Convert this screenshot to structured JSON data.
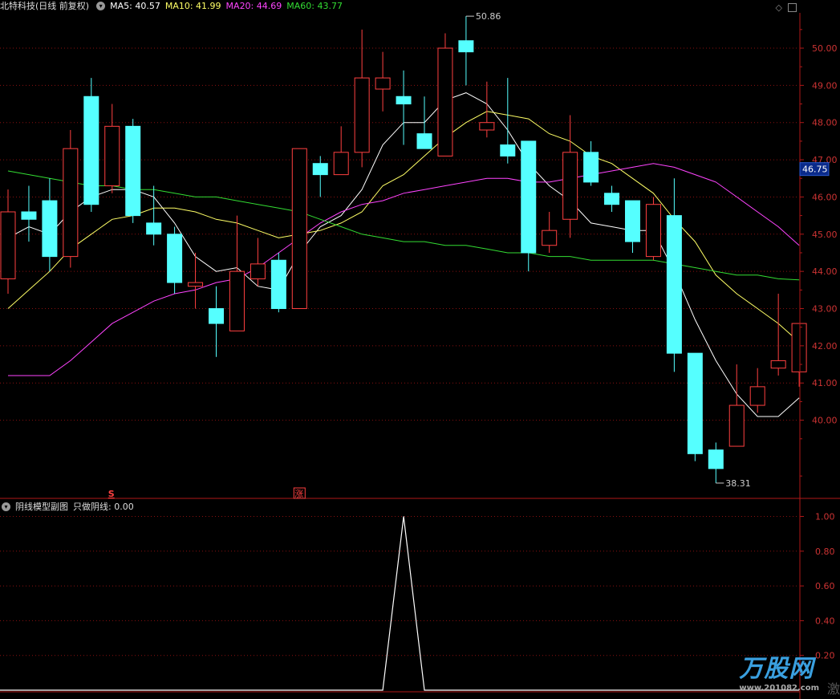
{
  "header": {
    "title": "北特科技(日线 前复权)",
    "ma5": {
      "label": "MA5:",
      "value": "40.57",
      "color": "#ffffff"
    },
    "ma10": {
      "label": "MA10:",
      "value": "41.99",
      "color": "#ffff66"
    },
    "ma20": {
      "label": "MA20:",
      "value": "44.69",
      "color": "#ff44ff"
    },
    "ma60": {
      "label": "MA60:",
      "value": "43.77",
      "color": "#33dd33"
    }
  },
  "sub_header": {
    "title": "阴线模型副图",
    "indicator_label": "只做阴线:",
    "indicator_value": "0.00"
  },
  "markers": {
    "s_label": "S",
    "zhang_label": "涨"
  },
  "price_labels": {
    "high": "50.86",
    "low": "38.31",
    "current": "46.75"
  },
  "watermark": {
    "brand": "万股网",
    "url": "www.201082.com",
    "corner": "激"
  },
  "colors": {
    "up": "#ff4040",
    "down": "#55ffff",
    "grid": "#8a1010",
    "axis": "#b01818",
    "tick": "#cc3333"
  },
  "chart_data": [
    {
      "type": "candlestick",
      "y_axis_ticks": [
        40.0,
        41.0,
        42.0,
        43.0,
        44.0,
        45.0,
        46.0,
        47.0,
        48.0,
        49.0,
        50.0
      ],
      "ylim": [
        37.65,
        51.45
      ],
      "candles": [
        {
          "o": 43.8,
          "c": 45.6,
          "h": 46.2,
          "l": 43.4
        },
        {
          "o": 45.6,
          "c": 45.4,
          "h": 46.3,
          "l": 44.8
        },
        {
          "o": 45.9,
          "c": 44.4,
          "h": 46.5,
          "l": 44.0
        },
        {
          "o": 44.4,
          "c": 47.3,
          "h": 47.8,
          "l": 44.1
        },
        {
          "o": 48.7,
          "c": 45.8,
          "h": 49.2,
          "l": 45.6
        },
        {
          "o": 46.3,
          "c": 47.9,
          "h": 48.5,
          "l": 46.1
        },
        {
          "o": 47.9,
          "c": 45.5,
          "h": 48.1,
          "l": 45.3
        },
        {
          "o": 45.3,
          "c": 45.0,
          "h": 46.3,
          "l": 44.7
        },
        {
          "o": 45.0,
          "c": 43.7,
          "h": 45.2,
          "l": 43.4
        },
        {
          "o": 43.6,
          "c": 43.7,
          "h": 44.5,
          "l": 43.0
        },
        {
          "o": 43.0,
          "c": 42.6,
          "h": 43.6,
          "l": 41.7
        },
        {
          "o": 42.4,
          "c": 44.0,
          "h": 45.5,
          "l": 42.4
        },
        {
          "o": 43.8,
          "c": 44.2,
          "h": 44.9,
          "l": 43.6
        },
        {
          "o": 44.3,
          "c": 43.0,
          "h": 44.5,
          "l": 42.9
        },
        {
          "o": 43.0,
          "c": 47.3,
          "h": 47.3,
          "l": 43.0
        },
        {
          "o": 46.9,
          "c": 46.6,
          "h": 47.1,
          "l": 46.0
        },
        {
          "o": 46.6,
          "c": 47.2,
          "h": 47.9,
          "l": 46.6
        },
        {
          "o": 47.2,
          "c": 49.2,
          "h": 50.5,
          "l": 46.8
        },
        {
          "o": 48.9,
          "c": 49.2,
          "h": 49.9,
          "l": 48.3
        },
        {
          "o": 48.7,
          "c": 48.5,
          "h": 49.4,
          "l": 47.4
        },
        {
          "o": 47.7,
          "c": 47.3,
          "h": 48.7,
          "l": 47.3
        },
        {
          "o": 47.1,
          "c": 50.0,
          "h": 50.4,
          "l": 47.1
        },
        {
          "o": 50.2,
          "c": 49.9,
          "h": 50.86,
          "l": 49.0
        },
        {
          "o": 47.8,
          "c": 48.0,
          "h": 49.1,
          "l": 47.6
        },
        {
          "o": 47.4,
          "c": 47.1,
          "h": 49.2,
          "l": 46.9
        },
        {
          "o": 47.5,
          "c": 44.5,
          "h": 47.5,
          "l": 44.0
        },
        {
          "o": 44.7,
          "c": 45.1,
          "h": 45.6,
          "l": 44.5
        },
        {
          "o": 45.4,
          "c": 47.2,
          "h": 48.2,
          "l": 44.9
        },
        {
          "o": 47.2,
          "c": 46.4,
          "h": 47.5,
          "l": 46.3
        },
        {
          "o": 46.1,
          "c": 45.8,
          "h": 46.3,
          "l": 45.6
        },
        {
          "o": 45.9,
          "c": 44.8,
          "h": 45.9,
          "l": 44.5
        },
        {
          "o": 44.4,
          "c": 45.8,
          "h": 46.0,
          "l": 44.3
        },
        {
          "o": 45.5,
          "c": 41.8,
          "h": 46.5,
          "l": 41.3
        },
        {
          "o": 41.8,
          "c": 39.1,
          "h": 41.8,
          "l": 38.9
        },
        {
          "o": 39.2,
          "c": 38.7,
          "h": 39.4,
          "l": 38.31
        },
        {
          "o": 39.3,
          "c": 40.4,
          "h": 41.5,
          "l": 39.3
        },
        {
          "o": 40.4,
          "c": 40.9,
          "h": 41.4,
          "l": 40.2
        },
        {
          "o": 41.4,
          "c": 41.6,
          "h": 43.4,
          "l": 41.2
        },
        {
          "o": 41.3,
          "c": 42.6,
          "h": 42.6,
          "l": 40.9
        }
      ],
      "ma": [
        {
          "name": "MA5",
          "color": "#ffffff",
          "values": [
            44.9,
            45.2,
            45.0,
            45.6,
            46.0,
            46.2,
            46.2,
            46.0,
            45.3,
            44.4,
            44.0,
            44.1,
            43.6,
            43.5,
            44.5,
            45.2,
            45.5,
            46.2,
            47.4,
            48.0,
            48.0,
            48.6,
            48.8,
            48.5,
            47.8,
            46.9,
            46.3,
            45.9,
            45.3,
            45.2,
            45.1,
            45.1,
            44.0,
            42.7,
            41.6,
            40.7,
            40.1,
            40.1,
            40.6
          ]
        },
        {
          "name": "MA10",
          "color": "#ffff66",
          "values": [
            43.0,
            43.5,
            44.0,
            44.6,
            45.0,
            45.4,
            45.5,
            45.7,
            45.7,
            45.6,
            45.4,
            45.3,
            45.1,
            44.9,
            45.0,
            45.1,
            45.3,
            45.6,
            46.3,
            46.6,
            47.1,
            47.6,
            48.0,
            48.3,
            48.2,
            48.1,
            47.7,
            47.5,
            47.1,
            46.9,
            46.5,
            46.1,
            45.4,
            44.8,
            43.9,
            43.4,
            43.0,
            42.6,
            42.1
          ]
        },
        {
          "name": "MA20",
          "color": "#ff44ff",
          "values": [
            41.2,
            41.2,
            41.2,
            41.6,
            42.1,
            42.6,
            42.9,
            43.2,
            43.4,
            43.5,
            43.7,
            43.8,
            44.1,
            44.5,
            44.9,
            45.3,
            45.6,
            45.8,
            45.9,
            46.1,
            46.2,
            46.3,
            46.4,
            46.5,
            46.5,
            46.4,
            46.4,
            46.5,
            46.6,
            46.7,
            46.8,
            46.9,
            46.8,
            46.6,
            46.4,
            46.0,
            45.6,
            45.2,
            44.7
          ]
        },
        {
          "name": "MA60",
          "color": "#33dd33",
          "values": [
            46.7,
            46.6,
            46.5,
            46.4,
            46.3,
            46.3,
            46.2,
            46.2,
            46.1,
            46.0,
            46.0,
            45.9,
            45.8,
            45.7,
            45.6,
            45.4,
            45.2,
            45.0,
            44.9,
            44.8,
            44.8,
            44.7,
            44.7,
            44.6,
            44.5,
            44.5,
            44.4,
            44.4,
            44.3,
            44.3,
            44.3,
            44.3,
            44.2,
            44.1,
            44.0,
            43.9,
            43.9,
            43.8,
            43.77
          ]
        }
      ]
    },
    {
      "type": "line",
      "title": "阴线模型副图",
      "y_axis_ticks": [
        0.2,
        0.4,
        0.6,
        0.8,
        1.0
      ],
      "ylim": [
        -0.08,
        1.02
      ],
      "series": [
        {
          "name": "只做阴线",
          "color": "#ffffff",
          "values": [
            0,
            0,
            0,
            0,
            0,
            0,
            0,
            0,
            0,
            0,
            0,
            0,
            0,
            0,
            0,
            0,
            0,
            0,
            0,
            1,
            0,
            0,
            0,
            0,
            0,
            0,
            0,
            0,
            0,
            0,
            0,
            0,
            0,
            0,
            0,
            0,
            0,
            0,
            0
          ]
        }
      ]
    }
  ]
}
